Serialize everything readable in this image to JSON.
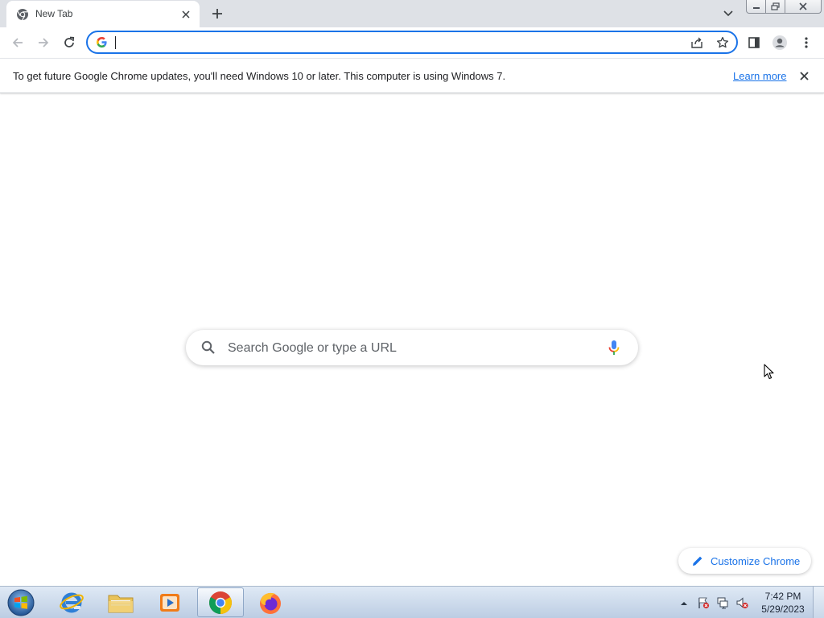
{
  "browser": {
    "tab": {
      "title": "New Tab"
    },
    "window_controls": [
      "minimize",
      "restore",
      "close"
    ],
    "omnibox": {
      "value": "",
      "placeholder": ""
    },
    "toolbar_icons": [
      "back-icon",
      "forward-icon",
      "reload-icon",
      "share-icon",
      "bookmark-star-icon",
      "side-panel-icon",
      "profile-icon",
      "menu-icon"
    ]
  },
  "infobar": {
    "message": "To get future Google Chrome updates, you'll need Windows 10 or later. This computer is using Windows 7.",
    "link": "Learn more"
  },
  "ntp": {
    "search_placeholder": "Search Google or type a URL",
    "customize_label": "Customize Chrome"
  },
  "taskbar": {
    "apps": [
      "Internet Explorer",
      "Windows Explorer",
      "Windows Media Player",
      "Google Chrome",
      "Firefox"
    ],
    "active_app": "Google Chrome",
    "clock": {
      "time": "7:42 PM",
      "date": "5/29/2023"
    }
  },
  "colors": {
    "accent": "#1a73e8",
    "tabstrip": "#dee1e6",
    "text": "#202124"
  }
}
